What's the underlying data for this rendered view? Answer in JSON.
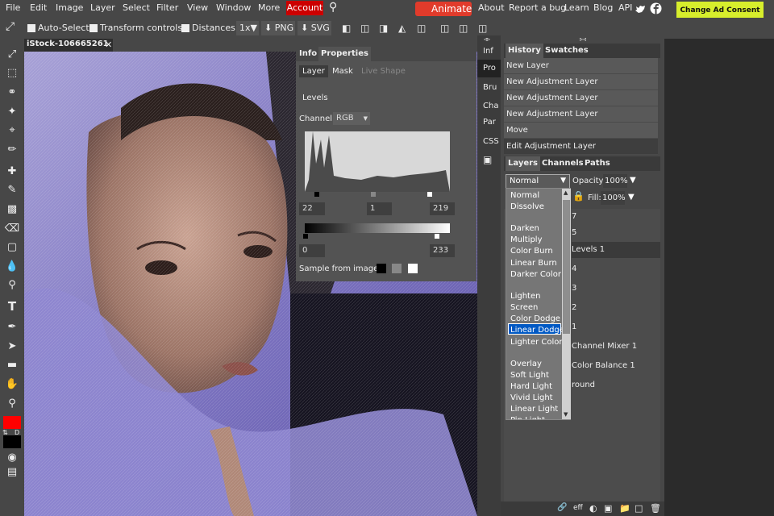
{
  "menu": {
    "items": [
      "File",
      "Edit",
      "Image",
      "Layer",
      "Select",
      "Filter",
      "View",
      "Window",
      "More"
    ],
    "account": "Account",
    "animate": "Animate",
    "links": [
      "About",
      "Report a bug",
      "Learn",
      "Blog",
      "API"
    ],
    "ad_consent": "Change Ad Consent"
  },
  "toolbar": {
    "auto_select": "Auto-Select",
    "transform_controls": "Transform controls",
    "distances": "Distances",
    "zoom": "1x",
    "png": "PNG",
    "svg": "SVG"
  },
  "document": {
    "tab_title": "iStock-106665261⁠"
  },
  "properties": {
    "tabs": [
      "Info",
      "Properties"
    ],
    "subtabs": [
      "Layer",
      "Mask",
      "Live Shape"
    ],
    "section": "Levels",
    "channel_label": "Channel:",
    "channel_value": "RGB",
    "input_black": "22",
    "input_gamma": "1",
    "input_white": "219",
    "output_black": "0",
    "output_white": "233",
    "sample_label": "Sample from image:"
  },
  "narrow": {
    "items": [
      "Inf",
      "Pro",
      "Bru",
      "Cha",
      "Par",
      "CSS"
    ]
  },
  "history": {
    "tabs": [
      "History",
      "Swatches"
    ],
    "items": [
      "New Layer",
      "New Adjustment Layer",
      "New Adjustment Layer",
      "New Adjustment Layer",
      "Move",
      "Edit Adjustment Layer"
    ]
  },
  "layers": {
    "tabs": [
      "Layers",
      "Channels",
      "Paths"
    ],
    "blend_mode": "Normal",
    "opacity_label": "Opacity:",
    "opacity_value": "100%",
    "fill_label": "Fill:",
    "fill_value": "100%",
    "rows": [
      "7",
      "5",
      "Levels 1",
      "4",
      "3",
      "2",
      "1",
      "Channel Mixer 1",
      "Color Balance 1",
      "round"
    ]
  },
  "blend_modes": [
    "Normal",
    "Dissolve",
    "Darken",
    "Multiply",
    "Color Burn",
    "Linear Burn",
    "Darker Color",
    "Lighten",
    "Screen",
    "Color Dodge",
    "Linear Dodge",
    "Lighter Color",
    "Overlay",
    "Soft Light",
    "Hard Light",
    "Vivid Light",
    "Linear Light",
    "Pin Light"
  ],
  "blend_selected": "Linear Dodge",
  "colors": {
    "foreground": "#ff0000",
    "background": "#000000",
    "accent": "#0059c4"
  }
}
